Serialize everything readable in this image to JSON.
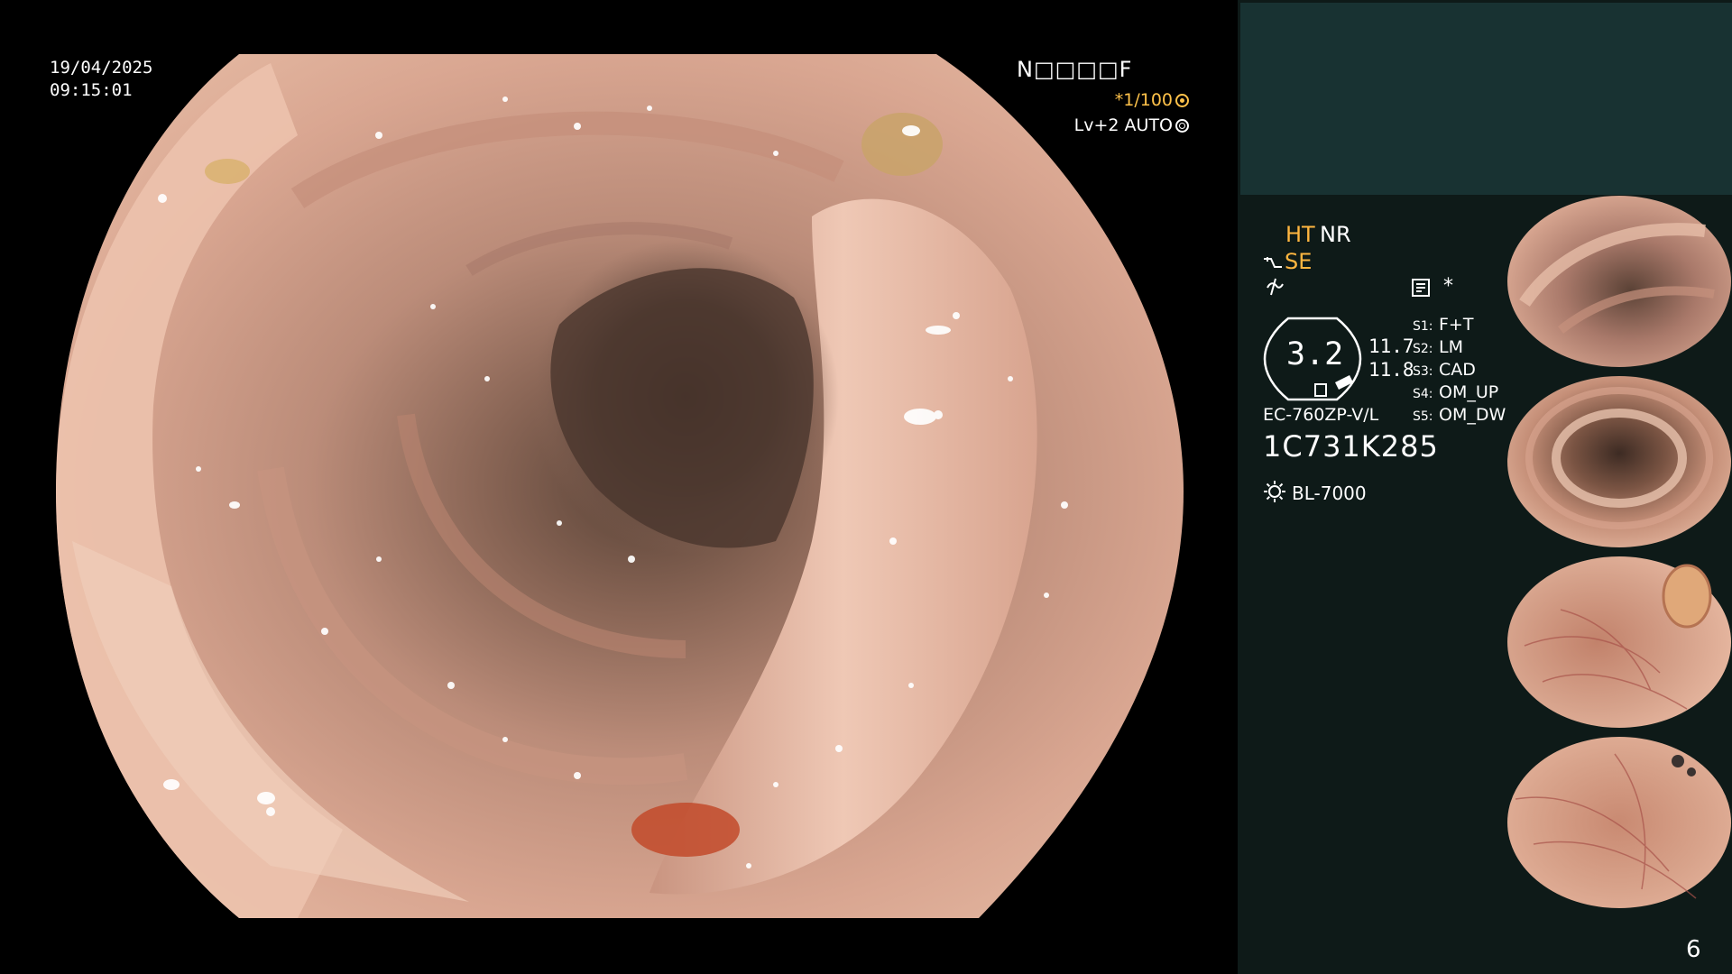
{
  "overlay": {
    "date": "19/04/2025",
    "time": "09:15:01",
    "patient_id": "N□□□□F",
    "shutter": "*1/100",
    "shutter_icon": "shutter-icon",
    "level": "Lv+2 AUTO",
    "level_icon": "auto-iris-icon"
  },
  "panel": {
    "ht_label": "HT",
    "nr_label": "NR",
    "se_label": "SE",
    "star_label": "*",
    "gauge_value": "3.2",
    "value_a": "11.7",
    "value_b": "11.8",
    "scope_model": "EC-760ZP-V/L",
    "serial": "1C731K285",
    "light_source": "BL-7000",
    "settings": [
      {
        "key": "S1:",
        "value": "F+T"
      },
      {
        "key": "S2:",
        "value": "LM"
      },
      {
        "key": "S3:",
        "value": "CAD"
      },
      {
        "key": "S4:",
        "value": "OM_UP"
      },
      {
        "key": "S5:",
        "value": "OM_DW"
      }
    ],
    "page_number": "6"
  },
  "colors": {
    "panel_bg": "#0e1a18",
    "panel_top": "#183232",
    "accent_orange": "#ffb640",
    "mucosa": "#d9a28b"
  }
}
